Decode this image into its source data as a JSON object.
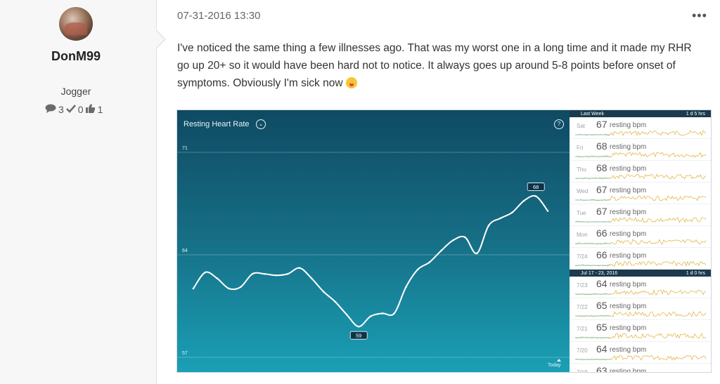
{
  "author": {
    "name": "DonM99",
    "rank": "Jogger",
    "stats": [
      {
        "icon": "comment-icon",
        "value": "3"
      },
      {
        "icon": "check-icon",
        "value": "0"
      },
      {
        "icon": "thumbs-up-icon",
        "value": "1"
      }
    ]
  },
  "post": {
    "date": "07-31-2016 13:30",
    "more_label": "•••",
    "body": "I've noticed the same thing a few illnesses ago. That was my worst one in a long time and it made my RHR go up 20+ so it would have been hard not to notice. It always goes up around 5-8 points before onset of symptoms. Obviously I'm sick now",
    "emoji": "tongue-wink-emoji"
  },
  "app": {
    "title": "Resting Heart Rate",
    "caret": "⌄",
    "help": "?",
    "today_label": "Today",
    "colors": {
      "line": "#ffffff",
      "bg_top": "#0f4a63",
      "bg_bottom": "#1aa0b6",
      "header": "#1b3a4d",
      "spark": "#e0b84a"
    }
  },
  "chart_data": {
    "type": "line",
    "title": "Resting Heart Rate",
    "ylim": [
      57,
      71
    ],
    "yticks": [
      71,
      64,
      57
    ],
    "y_direction": "values increase upward",
    "x": [
      "day 1",
      "day 2",
      "day 3",
      "day 4",
      "day 5",
      "day 6",
      "day 7",
      "day 8",
      "day 9",
      "day 10",
      "day 11",
      "day 12",
      "day 13",
      "day 14",
      "day 15",
      "day 16",
      "day 17",
      "day 18",
      "day 19",
      "day 20",
      "day 21",
      "day 22",
      "day 23",
      "day 24",
      "day 25",
      "day 26",
      "day 27",
      "day 28",
      "day 29",
      "day 30",
      "day 31",
      "day 32",
      "day 33",
      "day 34",
      "day 35",
      "day 36",
      "day 37",
      "day 38",
      "day 39",
      "day 40",
      "day 41",
      "day 42"
    ],
    "values": [
      61.7,
      62.8,
      62.4,
      61.7,
      61.8,
      62.7,
      62.7,
      62.6,
      62.7,
      63.1,
      62.4,
      61.5,
      60.8,
      59.9,
      59.1,
      59.8,
      60.0,
      60.0,
      61.8,
      63.0,
      63.5,
      64.3,
      65.0,
      65.2,
      64.1,
      66.0,
      66.5,
      66.9,
      67.7,
      68.0,
      67.0
    ],
    "callouts": [
      {
        "label": "59",
        "value": 59
      },
      {
        "label": "68",
        "value": 68
      }
    ]
  },
  "sidebar": {
    "groups": [
      {
        "header": "Last Week",
        "duration": "1 d 5 hrs",
        "rows": [
          {
            "day": "Sat",
            "value": "67",
            "unit": "resting bpm"
          },
          {
            "day": "Fri",
            "value": "68",
            "unit": "resting bpm"
          },
          {
            "day": "Thu",
            "value": "68",
            "unit": "resting bpm"
          },
          {
            "day": "Wed",
            "value": "67",
            "unit": "resting bpm"
          },
          {
            "day": "Tue",
            "value": "67",
            "unit": "resting bpm"
          },
          {
            "day": "Mon",
            "value": "66",
            "unit": "resting bpm"
          },
          {
            "day": "7/24",
            "value": "66",
            "unit": "resting bpm"
          }
        ]
      },
      {
        "header": "Jul 17 - 23, 2016",
        "duration": "1 d 0 hrs",
        "rows": [
          {
            "day": "7/23",
            "value": "64",
            "unit": "resting bpm"
          },
          {
            "day": "7/22",
            "value": "65",
            "unit": "resting bpm"
          },
          {
            "day": "7/21",
            "value": "65",
            "unit": "resting bpm"
          },
          {
            "day": "7/20",
            "value": "64",
            "unit": "resting bpm"
          },
          {
            "day": "7/19",
            "value": "63",
            "unit": "resting bpm"
          }
        ]
      }
    ]
  }
}
